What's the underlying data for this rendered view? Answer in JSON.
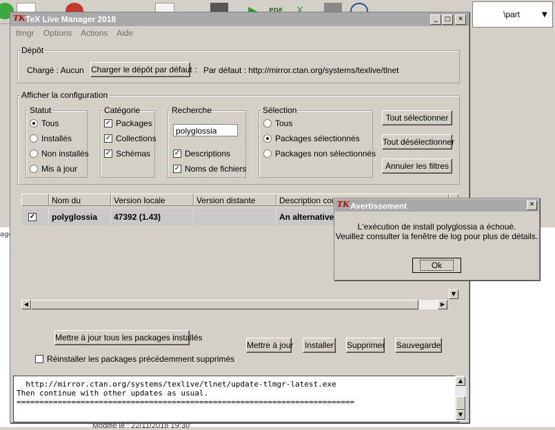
{
  "background": {
    "part_label": "\\part",
    "modified_text": "Modifié le : 22/11/2018 19:30",
    "left_fragment": "age"
  },
  "window": {
    "title": "TeX Live Manager 2018",
    "icon_text": "TK",
    "menu": [
      "tlmgr",
      "Options",
      "Actions",
      "Aide"
    ]
  },
  "depot": {
    "legend": "Dépôt",
    "loaded_label": "Chargé : Aucun",
    "load_button": "Charger le dépôt par défaut :",
    "default_label": "Par défaut : http://mirror.ctan.org/systems/texlive/tlnet"
  },
  "config": {
    "legend": "Afficher la configuration",
    "statut": {
      "legend": "Statut",
      "options": [
        "Tous",
        "Installés",
        "Non installés",
        "Mis à jour"
      ],
      "selected": 0
    },
    "categorie": {
      "legend": "Catégorie",
      "options": [
        "Packages",
        "Collections",
        "Schémas"
      ]
    },
    "recherche": {
      "legend": "Recherche",
      "value": "polyglossia",
      "options": [
        "Descriptions",
        "Noms de fichiers"
      ]
    },
    "selection": {
      "legend": "Sélection",
      "options": [
        "Tous",
        "Packages sélectionnés",
        "Packages non sélectionnés"
      ],
      "selected": 1
    },
    "buttons": [
      "Tout sélectionner",
      "Tout désélectionner",
      "Annuler les filtres"
    ]
  },
  "table": {
    "headers": [
      "Nom du package",
      "Version locale",
      "Version distante",
      "Description court"
    ],
    "rows": [
      {
        "name": "polyglossia",
        "local": "47392 (1.43)",
        "remote": "",
        "description": "An alternative"
      }
    ]
  },
  "actions": {
    "update_all": "Mettre à jour tous les packages installés",
    "reinstall": "Réinstaller les packages précédemment supprimés",
    "buttons": [
      "Mettre à jour",
      "Installer",
      "Supprimer",
      "Sauvegarde"
    ]
  },
  "log": {
    "lines": [
      "  http://mirror.ctan.org/systems/texlive/tlnet/update-tlmgr-latest.exe",
      "Then continue with other updates as usual.",
      "=========================================================================="
    ]
  },
  "dialog": {
    "title": "Avertissement",
    "line1": "L'exécution de install polyglossia a échoué.",
    "line2": "Veuillez consulter la fenêtre de log pour plus de détails.",
    "ok": "Ok"
  }
}
